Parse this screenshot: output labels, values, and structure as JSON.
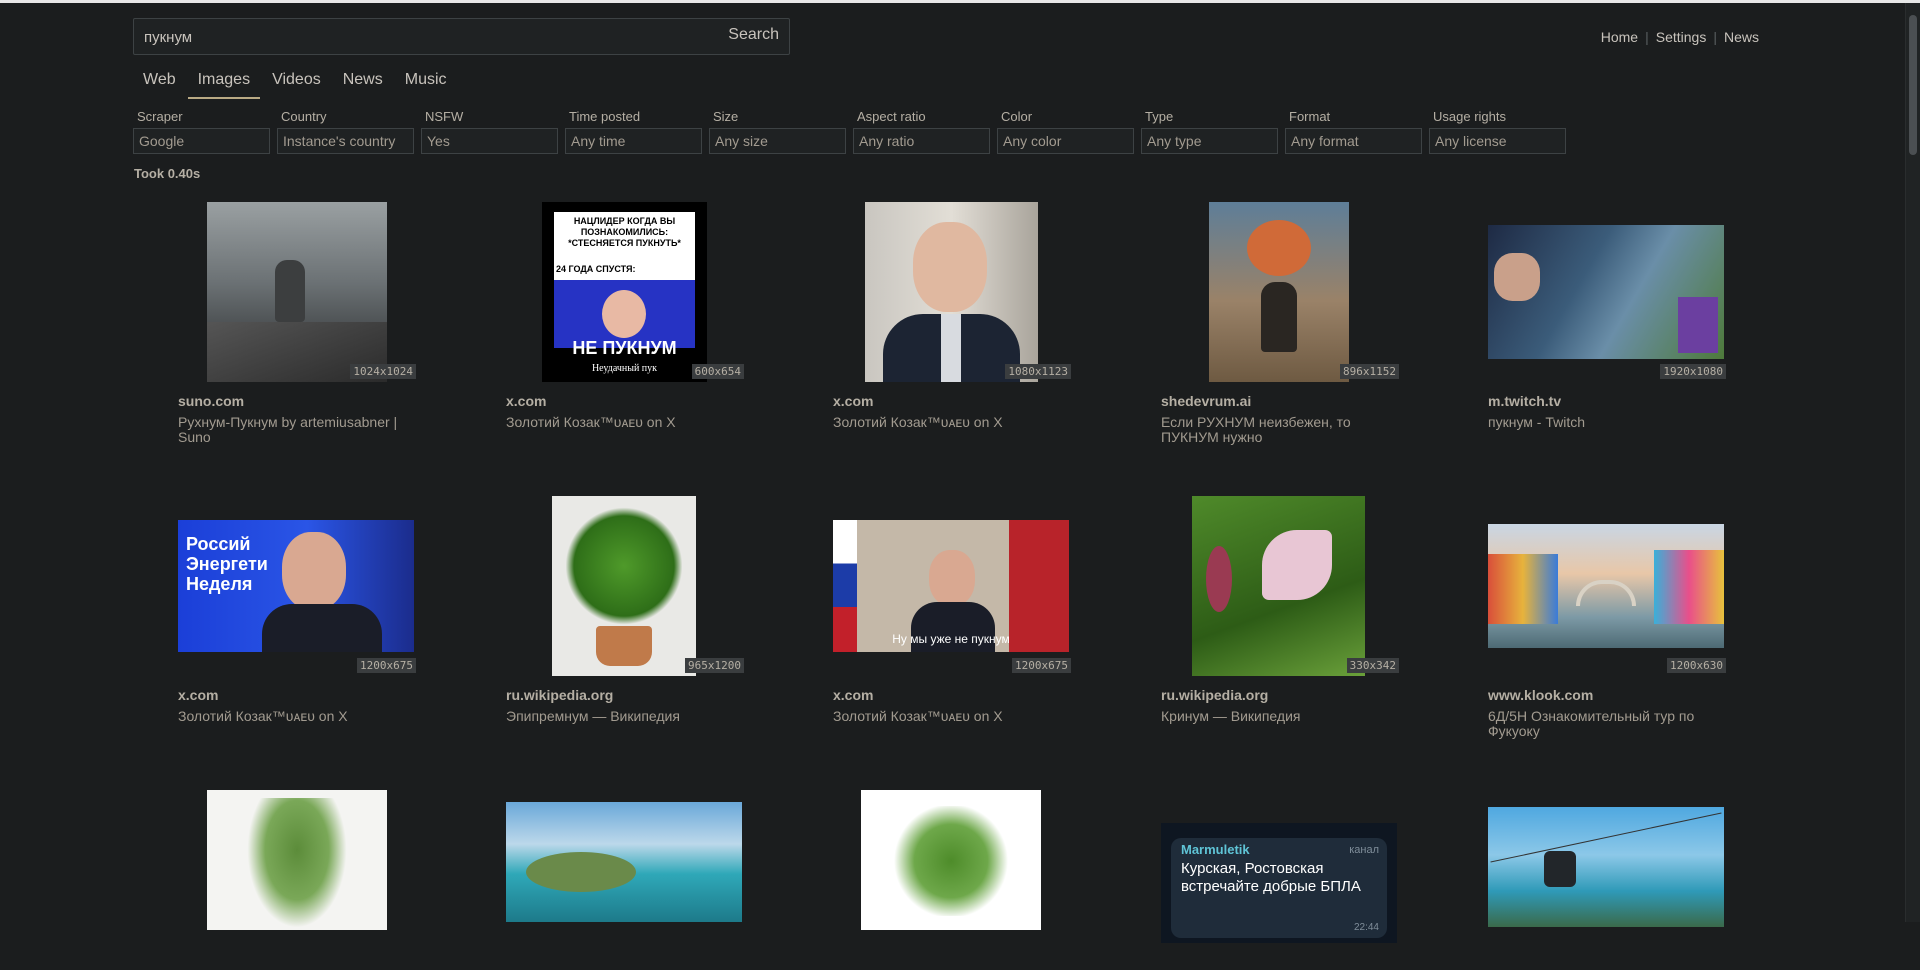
{
  "search": {
    "query": "пукнум",
    "button_label": "Search"
  },
  "top_links": [
    "Home",
    "Settings",
    "News"
  ],
  "tabs": [
    {
      "label": "Web",
      "active": false
    },
    {
      "label": "Images",
      "active": true
    },
    {
      "label": "Videos",
      "active": false
    },
    {
      "label": "News",
      "active": false
    },
    {
      "label": "Music",
      "active": false
    }
  ],
  "filters": [
    {
      "label": "Scraper",
      "value": "Google"
    },
    {
      "label": "Country",
      "value": "Instance's country"
    },
    {
      "label": "NSFW",
      "value": "Yes"
    },
    {
      "label": "Time posted",
      "value": "Any time"
    },
    {
      "label": "Size",
      "value": "Any size"
    },
    {
      "label": "Aspect ratio",
      "value": "Any ratio"
    },
    {
      "label": "Color",
      "value": "Any color"
    },
    {
      "label": "Type",
      "value": "Any type"
    },
    {
      "label": "Format",
      "value": "Any format"
    },
    {
      "label": "Usage rights",
      "value": "Any license"
    }
  ],
  "took": "Took 0.40s",
  "colors": {
    "accent": "#b9aa84",
    "background": "#1b1d1e"
  },
  "results": [
    {
      "site": "suno.com",
      "title": "Рухнум-Пукнум by artemiusabner | Suno",
      "resolution": "1024x1024"
    },
    {
      "site": "x.com",
      "title": "Золотий Козак™ᴜᴀᴇᴜ on X",
      "resolution": "600x654",
      "meme_top": "НАЦЛИДЕР КОГДА ВЫ ПОЗНАКОМИЛИСЬ: *СТЕСНЯЕТСЯ ПУКНУТЬ*",
      "meme_mid": "24 ГОДА СПУСТЯ:",
      "meme_bottom": "НЕ ПУКНУМ",
      "meme_caption": "Неудачный пук"
    },
    {
      "site": "x.com",
      "title": "Золотий Козак™ᴜᴀᴇᴜ on X",
      "resolution": "1080x1123"
    },
    {
      "site": "shedevrum.ai",
      "title": "Если РУХНУМ неизбежен, то ПУКНУМ нужно",
      "resolution": "896x1152"
    },
    {
      "site": "m.twitch.tv",
      "title": "пукнум - Twitch",
      "resolution": "1920x1080"
    },
    {
      "site": "x.com",
      "title": "Золотий Козак™ᴜᴀᴇᴜ on X",
      "resolution": "1200x675",
      "overlay_text": "Россий Энергети Неделя"
    },
    {
      "site": "ru.wikipedia.org",
      "title": "Эпипремнум — Википедия",
      "resolution": "965x1200"
    },
    {
      "site": "x.com",
      "title": "Золотий Козак™ᴜᴀᴇᴜ on X",
      "resolution": "1200x675",
      "overlay_text": "Ну мы уже не пукнум"
    },
    {
      "site": "ru.wikipedia.org",
      "title": "Кринум — Википедия",
      "resolution": "330x342"
    },
    {
      "site": "www.klook.com",
      "title": "6Д/5Н Ознакомительный тур по Фукуоку",
      "resolution": "1200x630"
    },
    {
      "site": "",
      "title": "",
      "resolution": ""
    },
    {
      "site": "",
      "title": "",
      "resolution": ""
    },
    {
      "site": "",
      "title": "",
      "resolution": ""
    },
    {
      "site": "",
      "title": "",
      "resolution": "",
      "tg_author": "Marmuletik",
      "tg_tag": "канал",
      "tg_text": "Курская, Ростовская встречайте добрые БПЛА",
      "tg_time": "22:44"
    },
    {
      "site": "",
      "title": "",
      "resolution": ""
    }
  ]
}
